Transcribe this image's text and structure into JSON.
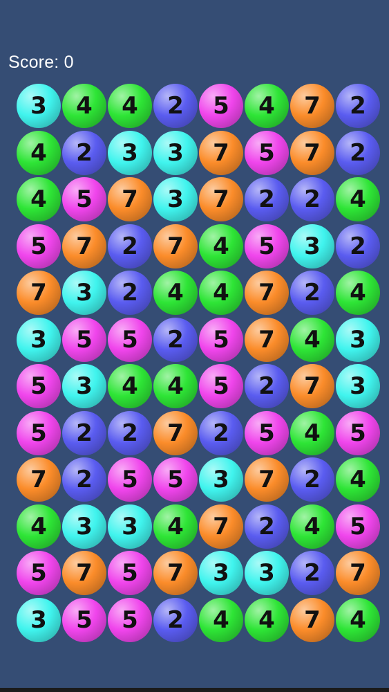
{
  "hud": {
    "score_label": "Score: 0"
  },
  "colors": {
    "background": "#354d74",
    "ball_2": "#5a5cf0",
    "ball_3": "#40f4ee",
    "ball_4": "#2ee536",
    "ball_5": "#f045ec",
    "ball_7": "#fb8c2a"
  },
  "grid": [
    [
      "3",
      "4",
      "4",
      "2",
      "5",
      "4",
      "7",
      "2"
    ],
    [
      "4",
      "2",
      "3",
      "3",
      "7",
      "5",
      "7",
      "2"
    ],
    [
      "4",
      "5",
      "7",
      "3",
      "7",
      "2",
      "2",
      "4"
    ],
    [
      "5",
      "7",
      "2",
      "7",
      "4",
      "5",
      "3",
      "2"
    ],
    [
      "7",
      "3",
      "2",
      "4",
      "4",
      "7",
      "2",
      "4"
    ],
    [
      "3",
      "5",
      "5",
      "2",
      "5",
      "7",
      "4",
      "3"
    ],
    [
      "5",
      "3",
      "4",
      "4",
      "5",
      "2",
      "7",
      "3"
    ],
    [
      "5",
      "2",
      "2",
      "7",
      "2",
      "5",
      "4",
      "5"
    ],
    [
      "7",
      "2",
      "5",
      "5",
      "3",
      "7",
      "2",
      "4"
    ],
    [
      "4",
      "3",
      "3",
      "4",
      "7",
      "2",
      "4",
      "5"
    ],
    [
      "5",
      "7",
      "5",
      "7",
      "3",
      "3",
      "2",
      "7"
    ],
    [
      "3",
      "5",
      "5",
      "2",
      "4",
      "4",
      "7",
      "4"
    ]
  ]
}
